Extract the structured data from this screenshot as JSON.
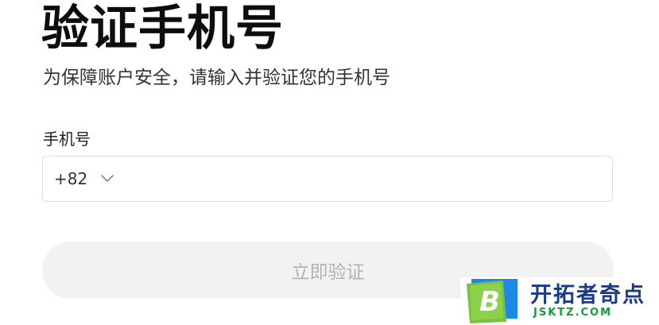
{
  "page": {
    "title": "验证手机号",
    "subtitle": "为保障账户安全，请输入并验证您的手机号"
  },
  "form": {
    "phone_label": "手机号",
    "country_code": "+82",
    "phone_value": "",
    "phone_placeholder": "",
    "submit_label": "立即验证",
    "submit_enabled": false
  },
  "icons": {
    "country_dropdown": "chevron-down-icon",
    "watermark_logo": "b-logo-icon"
  },
  "watermark": {
    "name": "开拓者奇点",
    "domain": "JSKTZ.COM"
  },
  "colors": {
    "title": "#0d0d0d",
    "button_bg_disabled": "#f2f2f2",
    "button_text_disabled": "#b3b3b3",
    "border": "#dcdcdc",
    "watermark_blue": "#1a3a8a",
    "watermark_green": "#1a9a3a"
  }
}
